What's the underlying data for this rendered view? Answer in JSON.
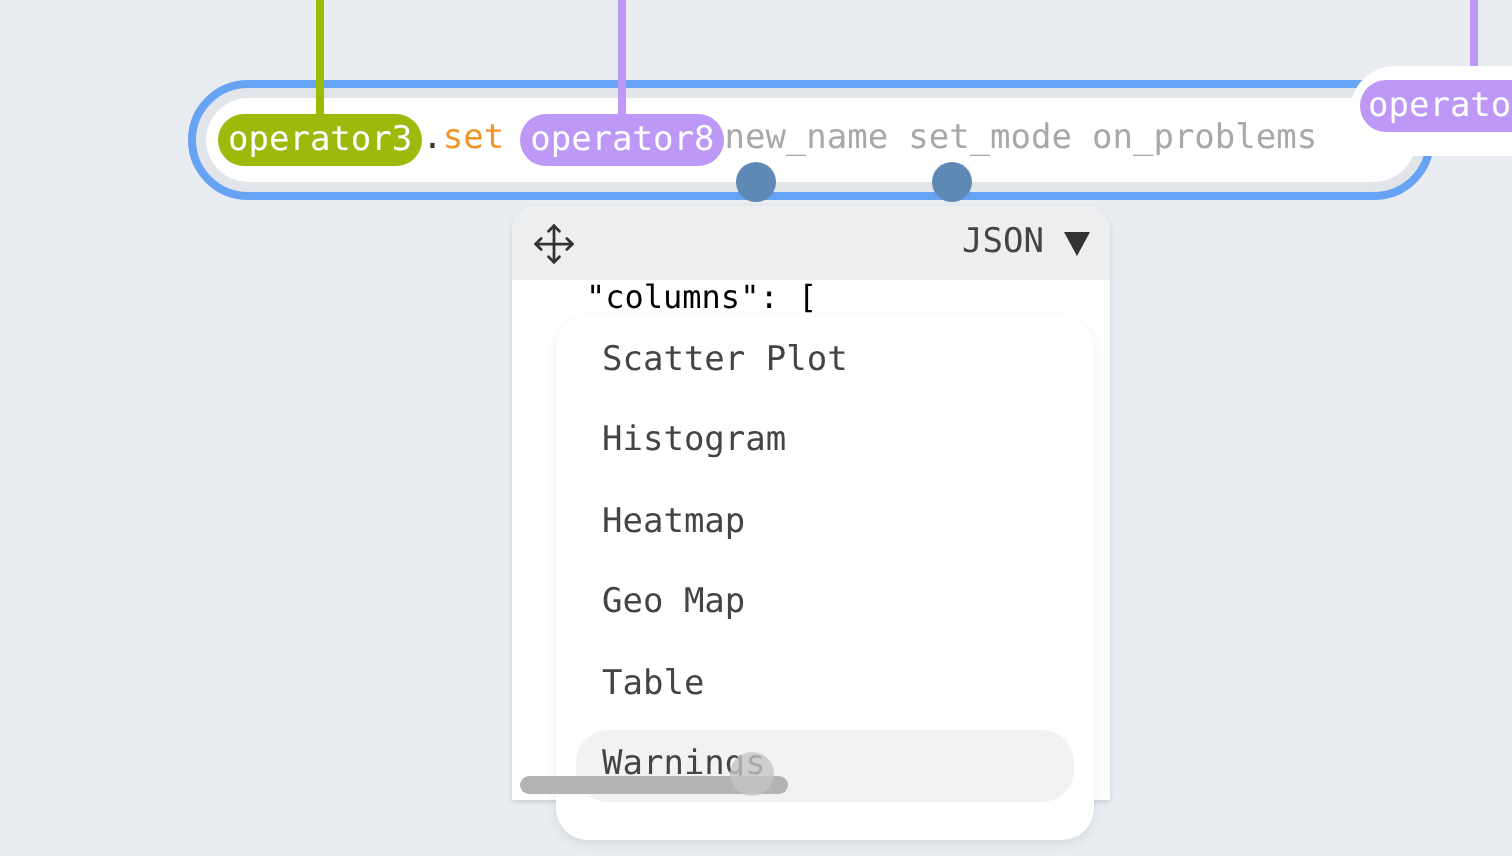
{
  "node": {
    "selected": true,
    "tokens": [
      {
        "kind": "operator",
        "text": "operator3",
        "color": "#9cba0c"
      },
      {
        "kind": "punct",
        "text": "."
      },
      {
        "kind": "method",
        "text": "set"
      },
      {
        "kind": "operator",
        "text": "operator8",
        "color": "#bd98f7"
      },
      {
        "kind": "param",
        "text": "new_name"
      },
      {
        "kind": "param",
        "text": "set_mode"
      },
      {
        "kind": "param",
        "text": "on_problems"
      }
    ]
  },
  "side_node": {
    "tag": {
      "text": "operato",
      "color": "#bd98f7"
    }
  },
  "panel": {
    "format": "JSON",
    "code_line": "\"columns\": [",
    "menu": [
      {
        "label": "Scatter Plot",
        "selected": false
      },
      {
        "label": "Histogram",
        "selected": false
      },
      {
        "label": "Heatmap",
        "selected": false
      },
      {
        "label": "Geo Map",
        "selected": false
      },
      {
        "label": "Table",
        "selected": false
      },
      {
        "label": "Warnings",
        "selected": true
      }
    ]
  }
}
